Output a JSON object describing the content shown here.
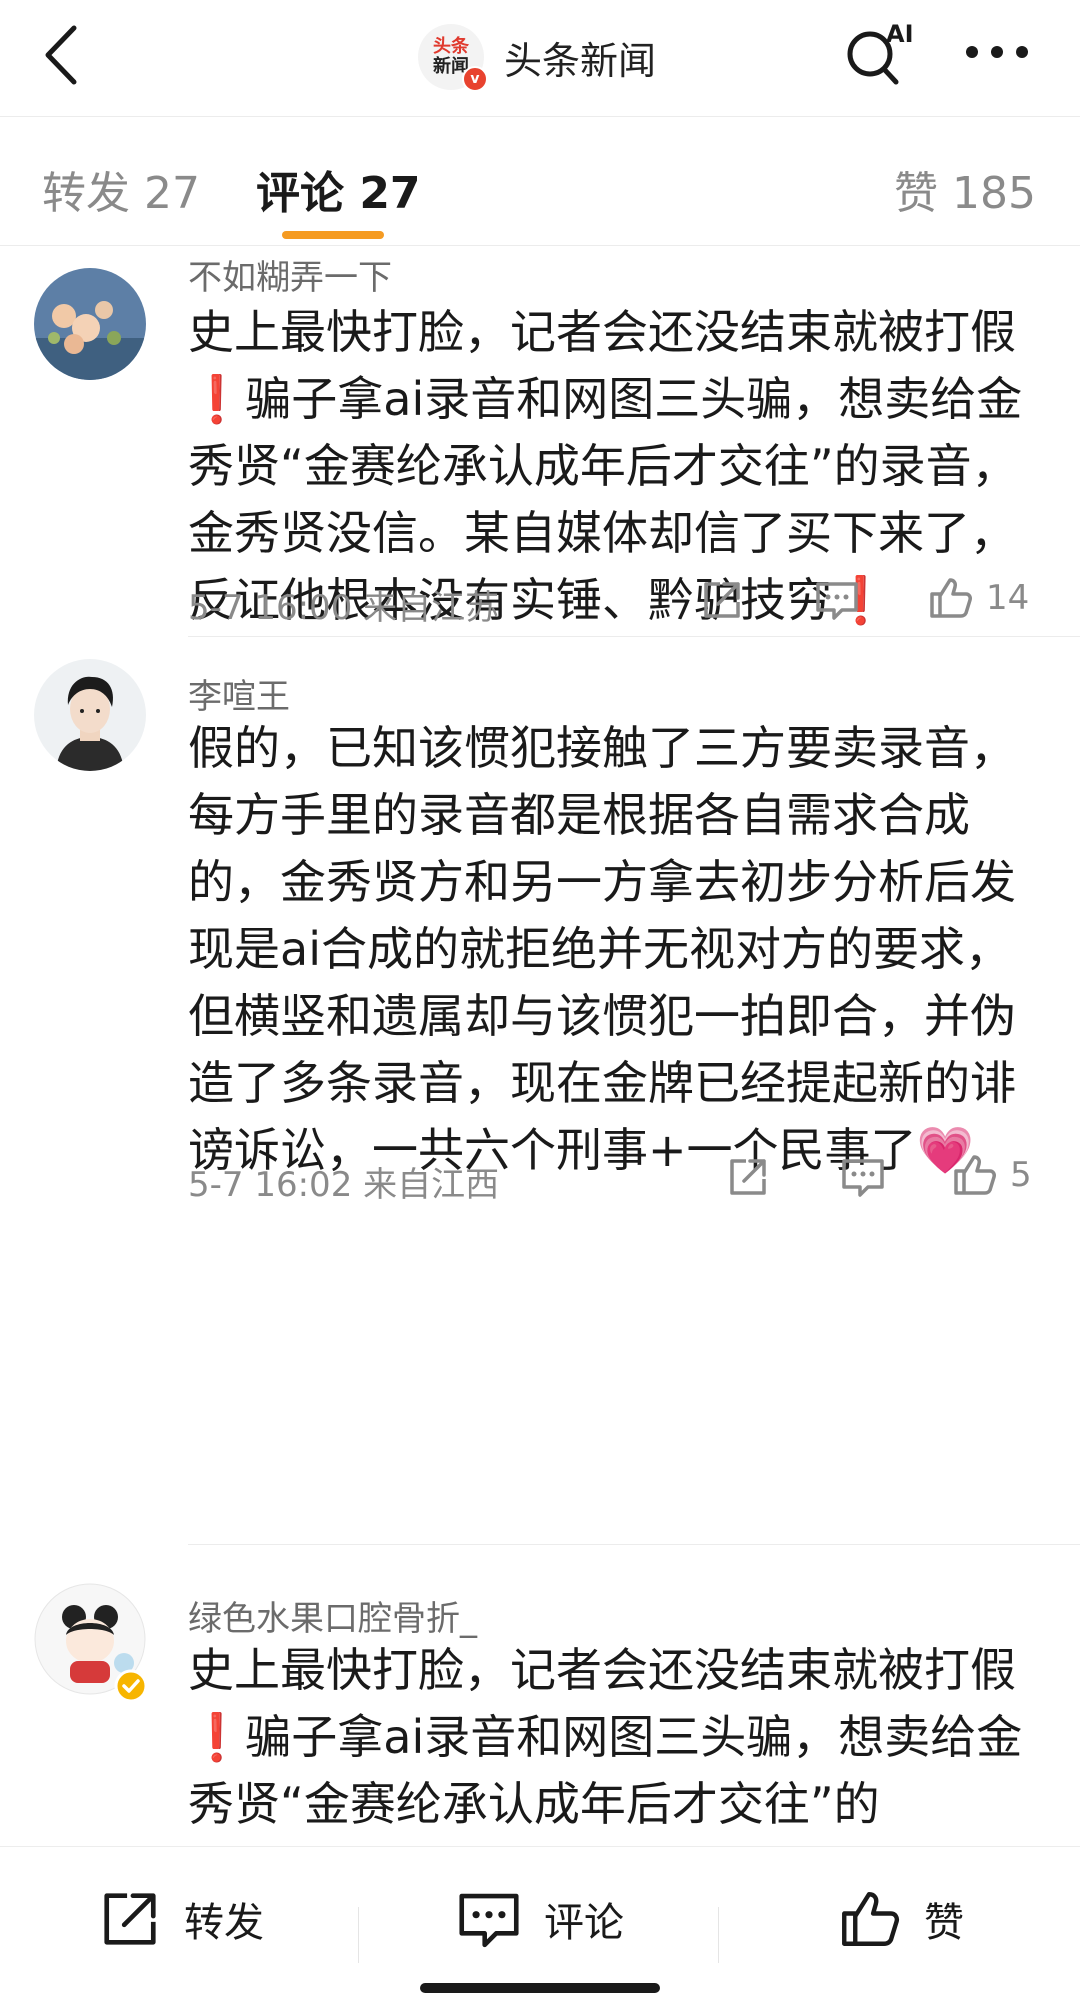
{
  "header": {
    "brand_logo_line1": "头条",
    "brand_logo_line2": "新闻",
    "brand_name": "头条新闻",
    "ai_label": "AI"
  },
  "tabs": {
    "repost": "转发 27",
    "comment": "评论 27",
    "like": "赞 185"
  },
  "comments": [
    {
      "username": "不如糊弄一下",
      "text_parts": [
        "史上最快打脸，记者会还没结束就被打假",
        "❗",
        "骗子拿ai录音和网图三头骗，想卖给金秀贤“金赛纶承认成年后才交往”的录音，金秀贤没信。某自媒体却信了买下来了，反证他根本没有实锤、黔驴技穷",
        "❗"
      ],
      "meta": "5-7 16:00  来自江苏",
      "likes": "14"
    },
    {
      "username": "李喧王",
      "text_parts": [
        "假的，已知该惯犯接触了三方要卖录音，每方手里的录音都是根据各自需求合成的，金秀贤方和另一方拿去初步分析后发现是ai合成的就拒绝并无视对方的要求，但横竖和遗属却与该惯犯一拍即合，并伪造了多条录音，现在金牌已经提起新的诽谤诉讼，一共六个刑事+一个民事了",
        "💗"
      ],
      "meta": "5-7 16:02  来自江西",
      "likes": "5"
    },
    {
      "username": "绿色水果口腔骨折_",
      "text_parts": [
        "史上最快打脸，记者会还没结束就被打假",
        "❗",
        "骗子拿ai录音和网图三头骗，想卖给金秀贤“金赛纶承认成年后才交往”的"
      ]
    }
  ],
  "bottom_bar": {
    "repost": "转发",
    "comment": "评论",
    "like": "赞"
  },
  "colors": {
    "accent": "#f59b22",
    "exclamation": "#e8322a",
    "muted": "#8a8a8a"
  }
}
